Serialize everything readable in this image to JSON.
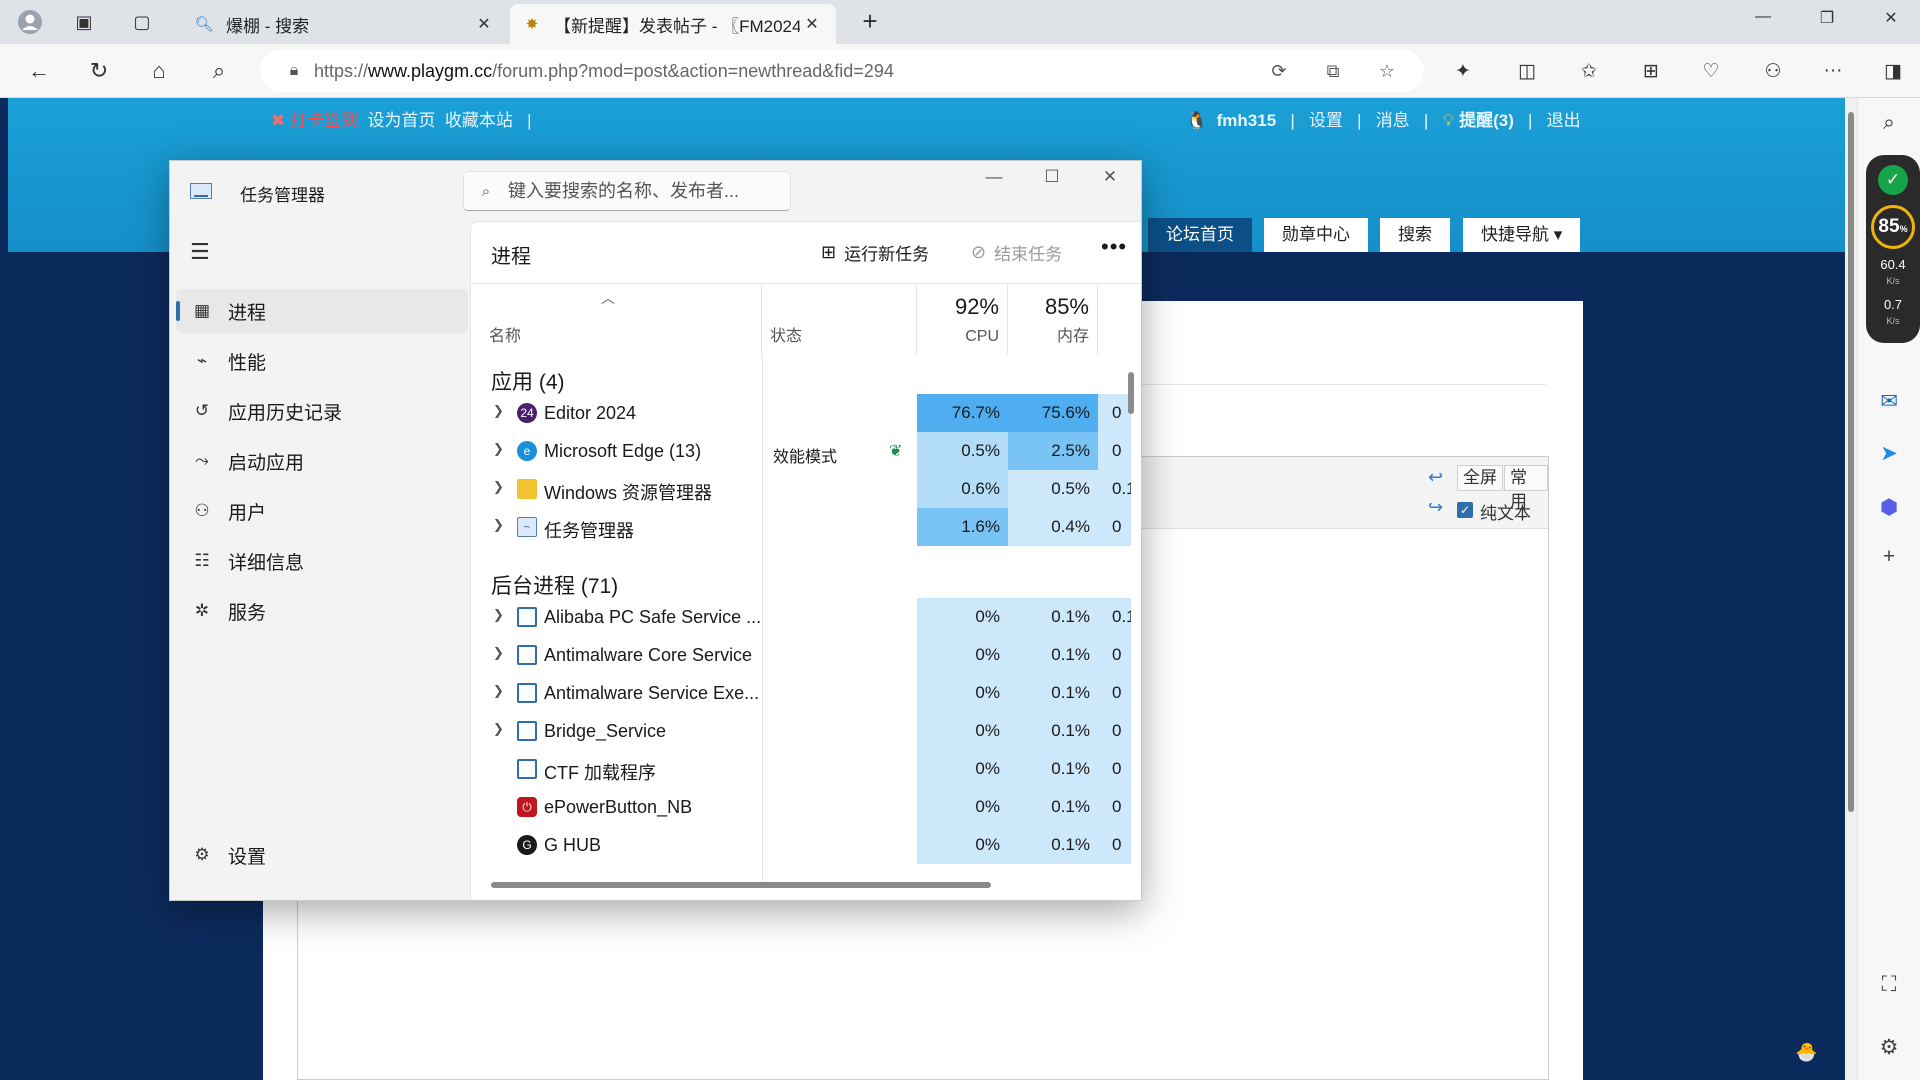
{
  "browser": {
    "tabs": [
      {
        "title": "爆棚 - 搜索",
        "icon": "search-icon"
      },
      {
        "title": "【新提醒】发表帖子 - 〖FM2024",
        "icon": "site-favicon"
      }
    ],
    "url_prefix": "https://",
    "url_host": "www.playgm.cc",
    "url_path": "/forum.php?mod=post&action=newthread&fid=294"
  },
  "site": {
    "topbar_left": {
      "checkin": "打卡签到",
      "home": "设为首页",
      "bookmark": "收藏本站",
      "sep": "|"
    },
    "topbar_right": {
      "user": "fmh315",
      "settings": "设置",
      "messages": "消息",
      "reminders": "提醒(3)",
      "logout": "退出",
      "sep": "|"
    },
    "nav": [
      "论坛首页",
      "勋章中心",
      "搜索",
      "快捷导航"
    ],
    "editor": {
      "fullscreen": "全屏",
      "common": "常用",
      "plaintext": "纯文本"
    }
  },
  "sidebar_monitor": {
    "shield": "✓",
    "percent": "85",
    "up_speed": "60.4",
    "down_speed": "0.7",
    "unit": "K/s"
  },
  "taskmanager": {
    "title": "任务管理器",
    "search_placeholder": "键入要搜索的名称、发布者...",
    "nav": [
      "进程",
      "性能",
      "应用历史记录",
      "启动应用",
      "用户",
      "详细信息",
      "服务"
    ],
    "settings": "设置",
    "page_title": "进程",
    "run_new_task": "运行新任务",
    "end_task": "结束任务",
    "columns": {
      "name": "名称",
      "status": "状态",
      "cpu_total": "92%",
      "cpu": "CPU",
      "mem_total": "85%",
      "mem": "内存"
    },
    "apps_group": "应用 (4)",
    "apps": [
      {
        "name": "Editor 2024",
        "status": "",
        "cpu": "76.7%",
        "mem": "75.6%",
        "extra": "0",
        "icon": "fm-editor-icon"
      },
      {
        "name": "Microsoft Edge (13)",
        "status": "效能模式",
        "cpu": "0.5%",
        "mem": "2.5%",
        "extra": "0",
        "icon": "edge-icon"
      },
      {
        "name": "Windows 资源管理器",
        "status": "",
        "cpu": "0.6%",
        "mem": "0.5%",
        "extra": "0.1",
        "icon": "folder-icon"
      },
      {
        "name": "任务管理器",
        "status": "",
        "cpu": "1.6%",
        "mem": "0.4%",
        "extra": "0",
        "icon": "taskmgr-icon"
      }
    ],
    "bg_group": "后台进程 (71)",
    "background": [
      {
        "name": "Alibaba PC Safe Service ...",
        "cpu": "0%",
        "mem": "0.1%",
        "extra": "0.1",
        "expand": true,
        "icon": "service-icon"
      },
      {
        "name": "Antimalware Core Service",
        "cpu": "0%",
        "mem": "0.1%",
        "extra": "0",
        "expand": true,
        "icon": "service-icon"
      },
      {
        "name": "Antimalware Service Exe...",
        "cpu": "0%",
        "mem": "0.1%",
        "extra": "0",
        "expand": true,
        "icon": "service-icon"
      },
      {
        "name": "Bridge_Service",
        "cpu": "0%",
        "mem": "0.1%",
        "extra": "0",
        "expand": true,
        "icon": "service-icon"
      },
      {
        "name": "CTF 加载程序",
        "cpu": "0%",
        "mem": "0.1%",
        "extra": "0",
        "expand": false,
        "icon": "service-icon"
      },
      {
        "name": "ePowerButton_NB",
        "cpu": "0%",
        "mem": "0.1%",
        "extra": "0",
        "expand": false,
        "icon": "power-icon"
      },
      {
        "name": "G HUB",
        "cpu": "0%",
        "mem": "0.1%",
        "extra": "0",
        "expand": false,
        "icon": "ghub-icon"
      }
    ]
  }
}
